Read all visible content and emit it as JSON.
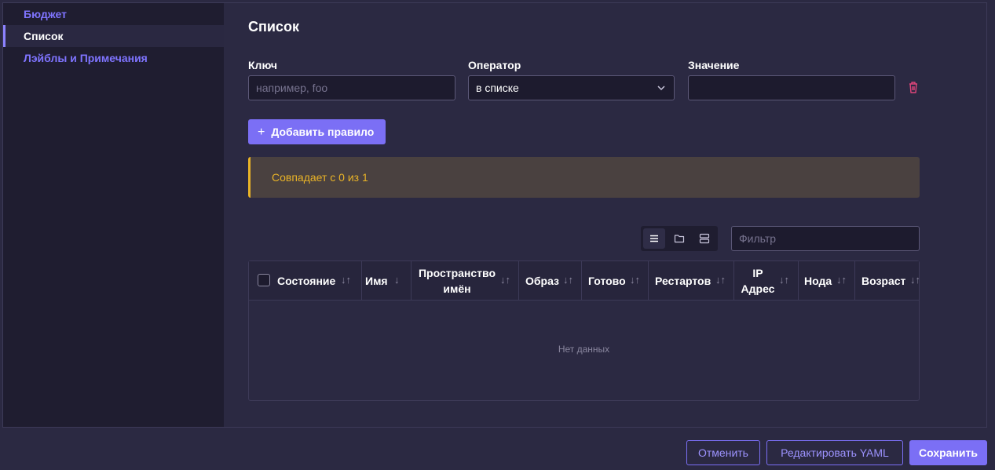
{
  "sidebar": {
    "items": [
      {
        "label": "Бюджет"
      },
      {
        "label": "Список"
      },
      {
        "label": "Лэйблы и Примечания"
      }
    ]
  },
  "main": {
    "title": "Список",
    "rule": {
      "key_label": "Ключ",
      "key_placeholder": "например, foo",
      "operator_label": "Оператор",
      "operator_value": "в списке",
      "value_label": "Значение",
      "value_value": ""
    },
    "add_rule_label": "Добавить правило",
    "match_text": "Совпадает с 0 из 1",
    "filter_placeholder": "Фильтр",
    "table": {
      "columns": [
        "Состояние",
        "Имя",
        "Пространство имён",
        "Образ",
        "Готово",
        "Рестартов",
        "IP Адрес",
        "Нода",
        "Возраст"
      ],
      "sort_icons": [
        "↓↑",
        "↓",
        "↓↑",
        "↓↑",
        "↓↑",
        "↓↑",
        "↓↑",
        "↓↑",
        "↓↑"
      ],
      "empty_text": "Нет данных"
    }
  },
  "footer": {
    "cancel_label": "Отменить",
    "edit_yaml_label": "Редактировать YAML",
    "save_label": "Сохранить"
  },
  "colors": {
    "accent": "#7b6ff5",
    "warning": "#e9b327",
    "danger": "#e0457b"
  },
  "icons": [
    "list-view-icon",
    "folder-view-icon",
    "group-view-icon",
    "trash-icon",
    "chevron-down-icon",
    "plus-icon"
  ]
}
